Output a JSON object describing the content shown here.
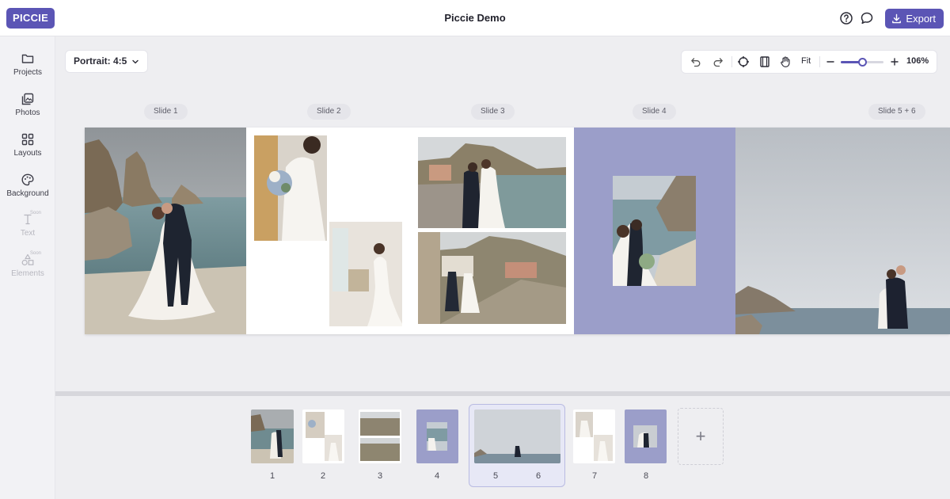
{
  "header": {
    "brand": "PICCIE",
    "title": "Piccie Demo",
    "export_label": "Export",
    "help_icon": "help-circle-icon",
    "chat_icon": "chat-bubble-icon"
  },
  "sidebar": {
    "items": [
      {
        "label": "Projects",
        "icon": "folder-icon"
      },
      {
        "label": "Photos",
        "icon": "photos-icon"
      },
      {
        "label": "Layouts",
        "icon": "grid-icon"
      },
      {
        "label": "Background",
        "icon": "palette-icon"
      },
      {
        "label": "Text",
        "icon": "text-icon",
        "badge": "Soon"
      },
      {
        "label": "Elements",
        "icon": "shapes-icon",
        "badge": "Soon"
      }
    ]
  },
  "toolbar": {
    "ratio": "Portrait: 4:5",
    "fit_label": "Fit",
    "zoom_label": "106%",
    "zoom_fraction": 0.5
  },
  "slides": {
    "labels": [
      "Slide 1",
      "Slide 2",
      "Slide 3",
      "Slide 4",
      "Slide 5 + 6"
    ]
  },
  "thumbnails": {
    "numbers": [
      "1",
      "2",
      "3",
      "4",
      "5",
      "6",
      "7",
      "8"
    ],
    "add_symbol": "+"
  },
  "colors": {
    "accent": "#5b55b5",
    "slide4_bg": "#9b9ec9"
  }
}
